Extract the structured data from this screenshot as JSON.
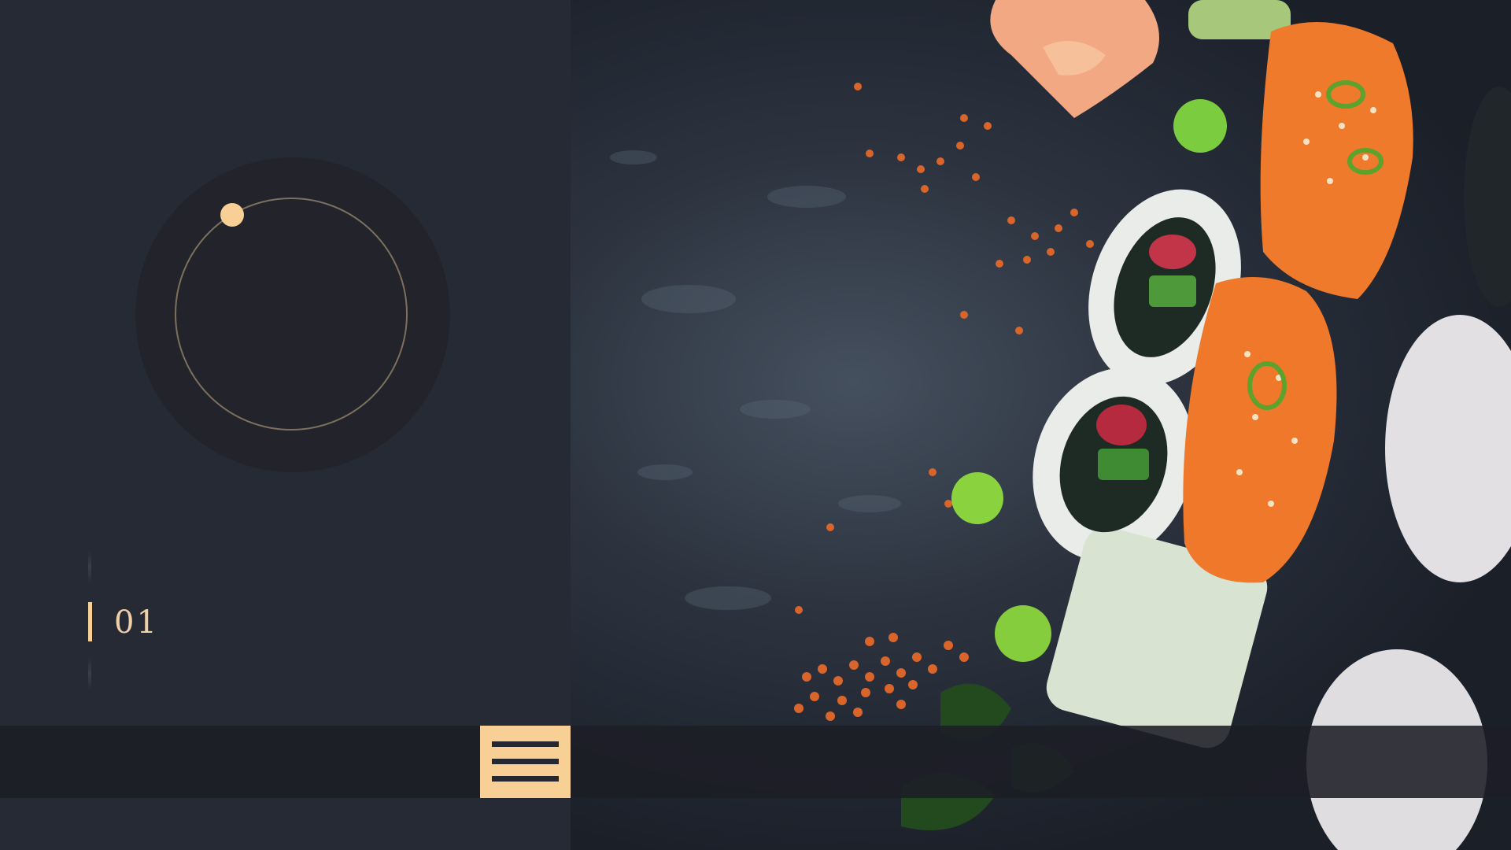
{
  "slider": {
    "current_number": "01"
  },
  "menu": {
    "icon": "hamburger-menu-icon"
  },
  "hero_image": {
    "subject": "sushi-platter-photo"
  },
  "colors": {
    "background": "#262a35",
    "dial_outer": "#22232b",
    "accent": "#f8cf94",
    "ring": "#7d705e",
    "menu_bar": "#1c1e26"
  }
}
